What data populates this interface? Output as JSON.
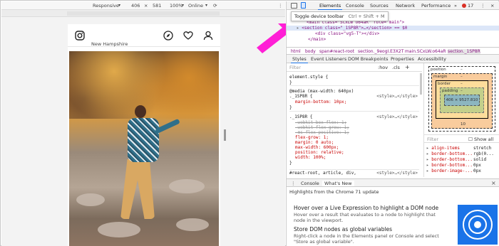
{
  "device_toolbar": {
    "device": "Responsive",
    "width": "406",
    "height": "581",
    "zoom": "100%",
    "network": "Online"
  },
  "instagram": {
    "subtitle": "New Hampshire"
  },
  "devtools": {
    "tabs": [
      "Elements",
      "Console",
      "Sources",
      "Network",
      "Performance"
    ],
    "more": "»",
    "error_count": "17",
    "tooltip": "Toggle device toolbar",
    "tooltip_shortcut": "Ctrl + Shift + M",
    "dom": {
      "line1": "<main class=\"SCxLW o64aR\" role=\"main\">",
      "line2_tag": "<section class=\"_1SP8R",
      "line2_rest": "\">…</section> == $0",
      "line3": "<div class=\"vg5-T\"></div>",
      "line4": "</main>"
    },
    "breadcrumbs": [
      "html",
      "body",
      "span#react-root",
      "section._9eogI.E3X2T",
      "main.SCxLW.o64aR",
      "section._1SP8R"
    ],
    "subtabs": [
      "Styles",
      "Event Listeners",
      "DOM Breakpoints",
      "Properties",
      "Accessibility"
    ],
    "filter_placeholder": "Filter",
    "hov": ":hov",
    "cls": ".cls",
    "plus": "+",
    "rules": {
      "element_style": "element.style {",
      "close": "}",
      "media": "@media (max-width: 640px)",
      "sel1": "._1SP8R {",
      "margin_bottom": "margin-bottom: 10px;",
      "sel2": "._1SP8R {",
      "wbf": "-webkit-box-flex: 1;",
      "wfg": "-webkit-flex-grow: 1;",
      "mfp": "-ms-flex-positive: 1;",
      "fg": "flex-grow: 1;",
      "margin": "margin: 0 auto;",
      "maxw": "max-width: 600px;",
      "pos": "position: relative;",
      "width": "width: 100%;",
      "sel3": "#react-root, article, div,",
      "src": "<style>…</style>"
    },
    "boxmodel": {
      "position": "position",
      "position_val": "–",
      "margin": "margin",
      "margin_val": "–",
      "border": "border",
      "border_val": "–",
      "padding": "padding",
      "padding_val": "–",
      "content": "406 × 9527.810",
      "bottom_margin": "10"
    },
    "computed_filter": "Filter",
    "show_all": "Show all",
    "computed": [
      {
        "k": "align-items",
        "v": "stretch"
      },
      {
        "k": "border-bottom...",
        "v": "rgb(0..."
      },
      {
        "k": "border-bottom...",
        "v": "solid"
      },
      {
        "k": "border-bottom...",
        "v": "0px"
      },
      {
        "k": "border-image-...",
        "v": "0px"
      }
    ],
    "drawer_tabs": [
      "Console",
      "What's New"
    ],
    "drawer_close": "×",
    "whats_new": {
      "header": "Highlights from the Chrome 71 update",
      "item1_title": "Hover over a Live Expression to highlight a DOM node",
      "item1_text": "Hover over a result that evaluates to a node to highlight that node in the viewport.",
      "item2_title": "Store DOM nodes as global variables",
      "item2_text": "Right-click a node in the Elements panel or Console and select \"Store as global variable\"."
    }
  },
  "colors": {
    "arrow": "#ff1fd6",
    "accent": "#1a73e8",
    "margin_box": "#f9cc9d",
    "border_box": "#fddd9b",
    "padding_box": "#c3d08b",
    "content_box": "#8cb6c0"
  }
}
